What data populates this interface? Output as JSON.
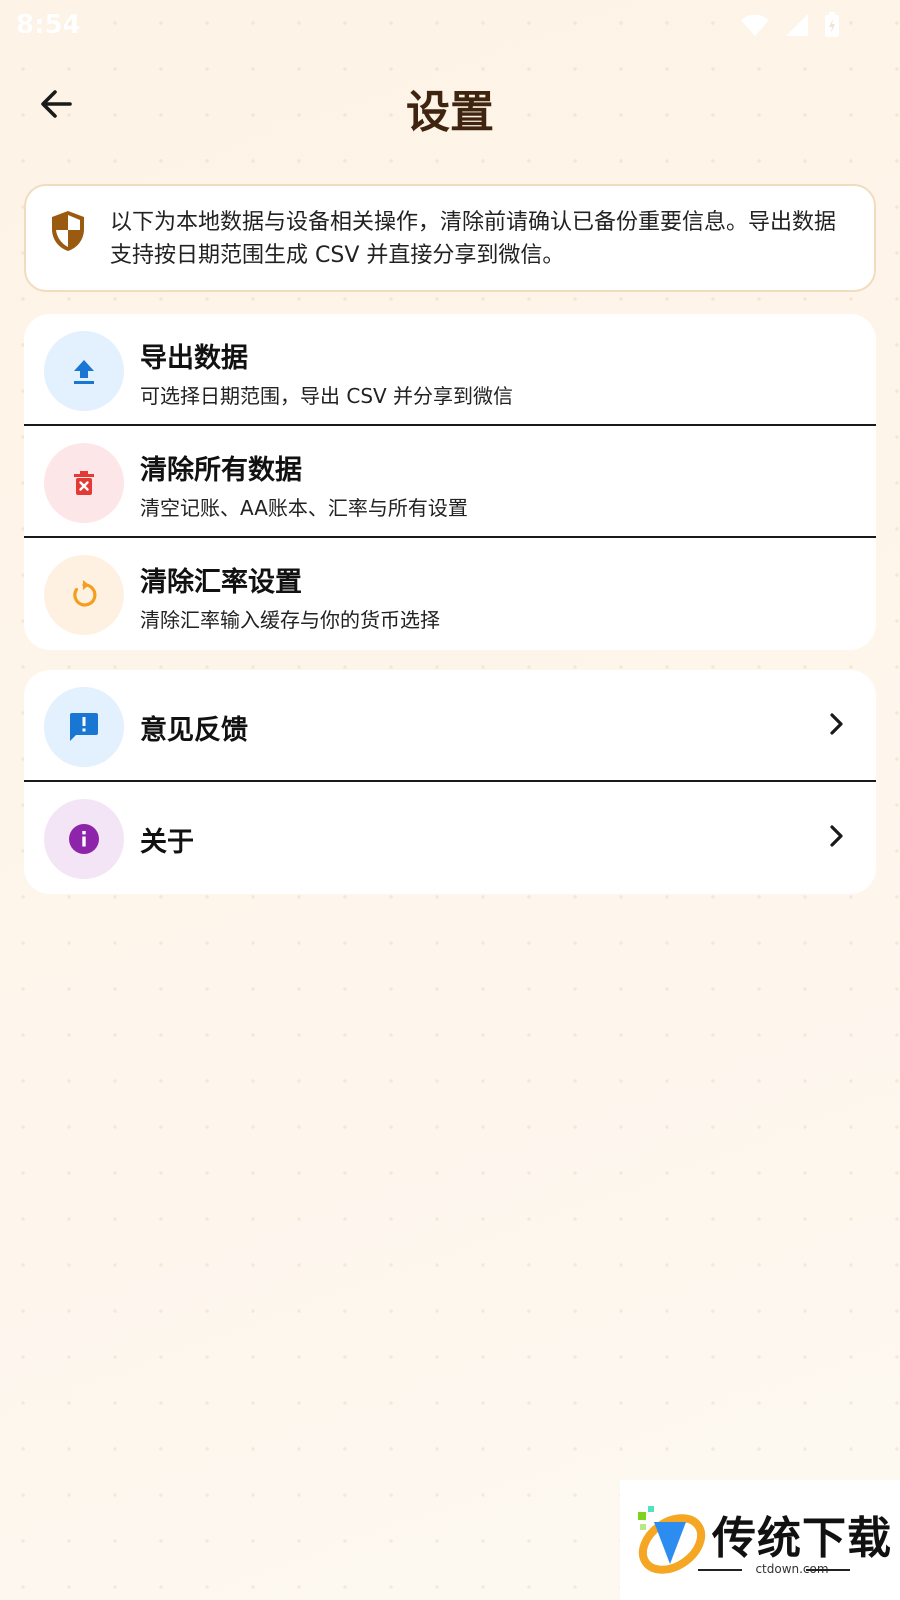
{
  "status_bar": {
    "time": "8:54"
  },
  "header": {
    "title": "设置"
  },
  "notice": {
    "text": "以下为本地数据与设备相关操作，清除前请确认已备份重要信息。导出数据支持按日期范围生成 CSV 并直接分享到微信。"
  },
  "data_actions": [
    {
      "title": "导出数据",
      "subtitle": "可选择日期范围，导出 CSV 并分享到微信",
      "icon": "upload-icon",
      "color": "#1976d2",
      "bg": "#e3f0fd"
    },
    {
      "title": "清除所有数据",
      "subtitle": "清空记账、AA账本、汇率与所有设置",
      "icon": "delete-icon",
      "color": "#e53935",
      "bg": "#fde6e8"
    },
    {
      "title": "清除汇率设置",
      "subtitle": "清除汇率输入缓存与你的货币选择",
      "icon": "refresh-icon",
      "color": "#f59d1e",
      "bg": "#fef1e1"
    }
  ],
  "other_items": [
    {
      "title": "意见反馈",
      "icon": "feedback-icon",
      "color": "#1976d2",
      "bg": "#e3f0fd"
    },
    {
      "title": "关于",
      "icon": "info-icon",
      "color": "#8e24aa",
      "bg": "#f3e5f5"
    }
  ],
  "watermark": {
    "brand": "传统下载",
    "url": "ctdown.com"
  }
}
